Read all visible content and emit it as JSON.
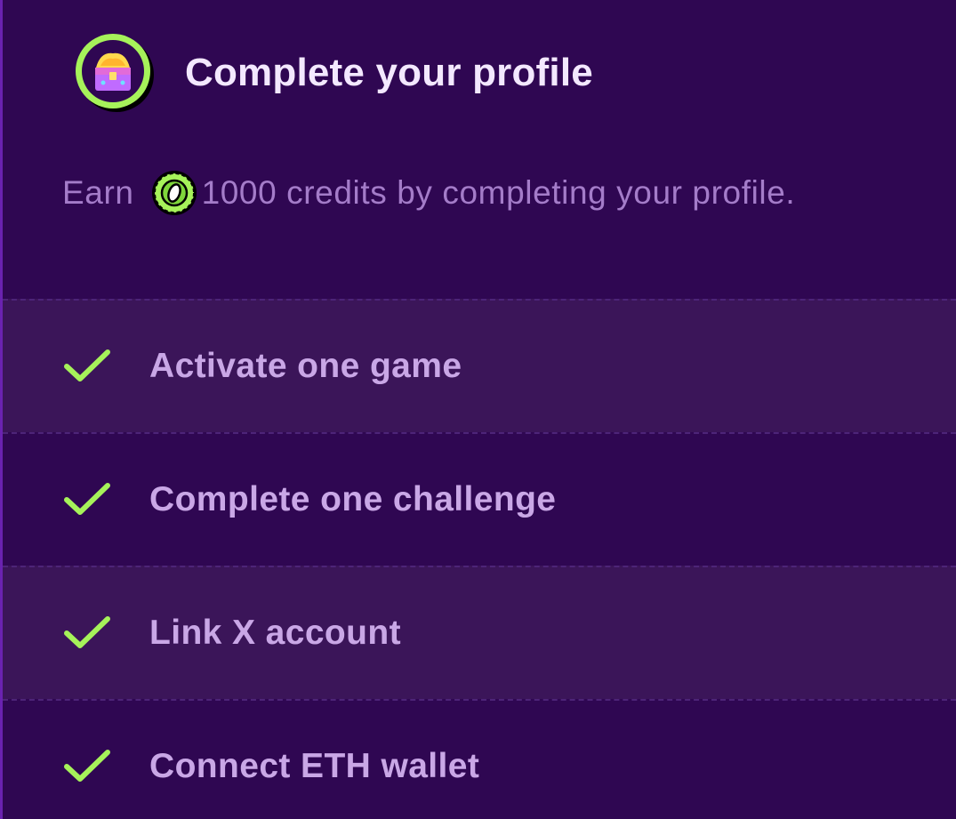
{
  "header": {
    "title": "Complete your profile",
    "badge_icon": "treasure-chest-icon"
  },
  "subtitle": {
    "prefix": "Earn",
    "coin_icon": "credit-coin-icon",
    "suffix": "1000 credits by completing your profile."
  },
  "tasks": [
    {
      "label": "Activate one game",
      "status": "completed",
      "icon": "checkmark-icon"
    },
    {
      "label": "Complete one challenge",
      "status": "completed",
      "icon": "checkmark-icon"
    },
    {
      "label": "Link X account",
      "status": "completed",
      "icon": "checkmark-icon"
    },
    {
      "label": "Connect ETH wallet",
      "status": "completed",
      "icon": "checkmark-icon"
    }
  ],
  "colors": {
    "background": "#2f0752",
    "row_alt": "#3b1559",
    "accent_green": "#a6f25a",
    "title": "#f3e8ff",
    "label": "#c9a7e6",
    "muted": "#a47cc9"
  }
}
